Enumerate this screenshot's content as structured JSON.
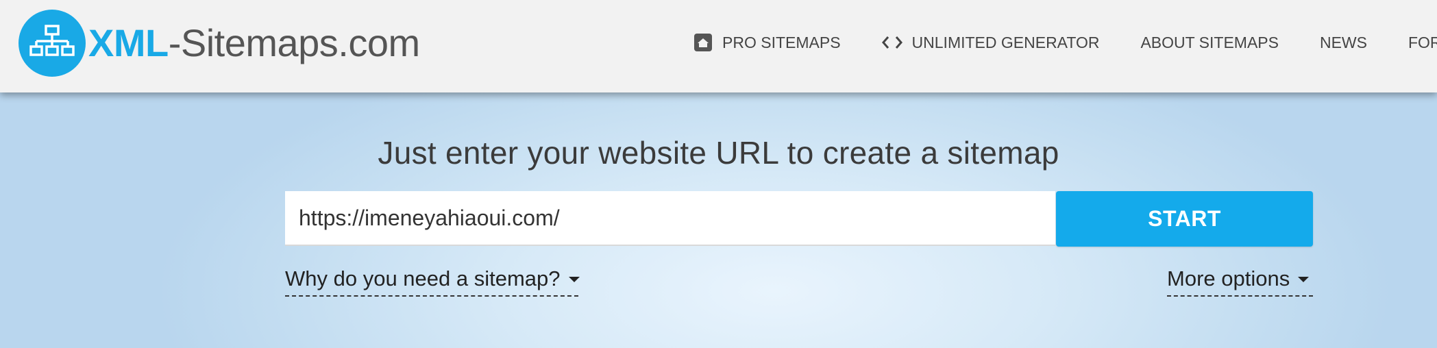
{
  "header": {
    "logo": {
      "brand_bold": "XML",
      "brand_rest": "-Sitemaps.com",
      "icon": "sitemap-tree-icon"
    },
    "nav": [
      {
        "label": "PRO SITEMAPS",
        "icon": "home-icon"
      },
      {
        "label": "UNLIMITED GENERATOR",
        "icon": "code-brackets-icon"
      },
      {
        "label": "ABOUT SITEMAPS",
        "icon": ""
      },
      {
        "label": "NEWS",
        "icon": ""
      },
      {
        "label": "FORU",
        "icon": ""
      }
    ]
  },
  "hero": {
    "headline": "Just enter your website URL to create a sitemap",
    "url_input": {
      "value": "https://imeneyahiaoui.com/",
      "placeholder": ""
    },
    "start_label": "START",
    "why_link": "Why do you need a sitemap?",
    "more_options": "More options"
  },
  "colors": {
    "brand_blue": "#19a9e6",
    "button_blue": "#14aaeb",
    "header_bg": "#f2f2f2",
    "hero_bg": "#d6e9f7"
  }
}
